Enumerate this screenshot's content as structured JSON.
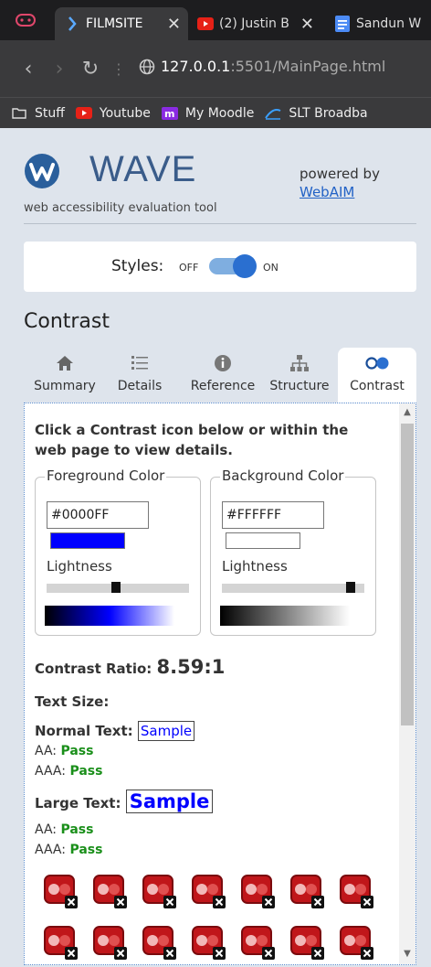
{
  "browser": {
    "tabs": [
      {
        "label": "FILMSITE",
        "active": true,
        "close": "✕"
      },
      {
        "label": "(2) Justin B",
        "active": false,
        "close": "✕"
      },
      {
        "label": "Sandun W",
        "active": false
      }
    ],
    "url_host": "127.0.0.1",
    "url_rest": ":5501/MainPage.html",
    "bookmarks": [
      "Stuff",
      "Youtube",
      "My Moodle",
      "SLT Broadba"
    ]
  },
  "wave": {
    "title": "WAVE",
    "subtitle": "web accessibility evaluation tool",
    "powered_by": "powered by",
    "webaim": "WebAIM",
    "styles_label": "Styles:",
    "off": "OFF",
    "on": "ON",
    "section": "Contrast",
    "tabs": [
      {
        "label": "Summary",
        "icon": "home-icon"
      },
      {
        "label": "Details",
        "icon": "list-icon"
      },
      {
        "label": "Reference",
        "icon": "info-icon"
      },
      {
        "label": "Structure",
        "icon": "sitemap-icon"
      },
      {
        "label": "Contrast",
        "icon": "contrast-icon"
      }
    ],
    "instructions": "Click a Contrast icon below or within the web page to view details.",
    "foreground": {
      "legend": "Foreground Color",
      "hex": "#0000FF",
      "lightness_label": "Lightness",
      "lightness": 0.5
    },
    "background": {
      "legend": "Background Color",
      "hex": "#FFFFFF",
      "lightness_label": "Lightness",
      "lightness": 1.0
    },
    "contrast_label": "Contrast Ratio:",
    "contrast_value": "8.59:1",
    "text_size": "Text Size:",
    "normal_label": "Normal Text:",
    "large_label": "Large Text:",
    "sample": "Sample",
    "aa": "AA:",
    "aaa": "AAA:",
    "pass": "Pass"
  },
  "colors": {
    "accent": "#2a6fd0",
    "pass": "#1a8f1a",
    "sample": "#0000ff",
    "error": "#c0161a"
  }
}
